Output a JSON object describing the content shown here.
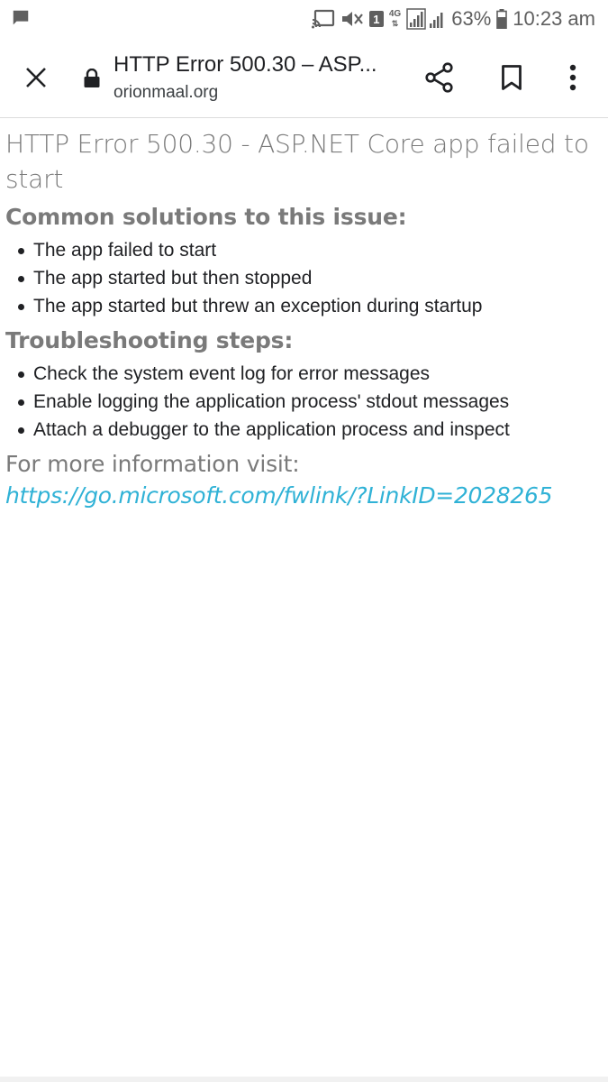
{
  "status_bar": {
    "net_type": "4G",
    "sim_badge": "1",
    "battery": "63%",
    "time": "10:23 am",
    "icons": [
      "message-icon",
      "cast-icon",
      "mute-icon",
      "sim-badge",
      "signal-icon",
      "battery-icon"
    ]
  },
  "toolbar": {
    "title": "HTTP Error 500.30 – ASP...",
    "domain": "orionmaal.org",
    "icons": [
      "close-icon",
      "lock-icon",
      "share-icon",
      "bookmark-icon",
      "more-vert-icon"
    ]
  },
  "page": {
    "heading": "HTTP Error 500.30 - ASP.NET Core app failed to start",
    "solutions_heading": "Common solutions to this issue:",
    "solutions": [
      "The app failed to start",
      "The app started but then stopped",
      "The app started but threw an exception during startup"
    ],
    "troubleshooting_heading": "Troubleshooting steps:",
    "steps": [
      "Check the system event log for error messages",
      "Enable logging the application process' stdout messages",
      "Attach a debugger to the application process and inspect"
    ],
    "more_info_text": "For more information visit:",
    "more_info_link": "https://go.microsoft.com/fwlink/?LinkID=2028265"
  },
  "colors": {
    "heading_gray": "#7a7a7a",
    "link_blue": "#30b2d6",
    "text_dark": "#202124"
  }
}
